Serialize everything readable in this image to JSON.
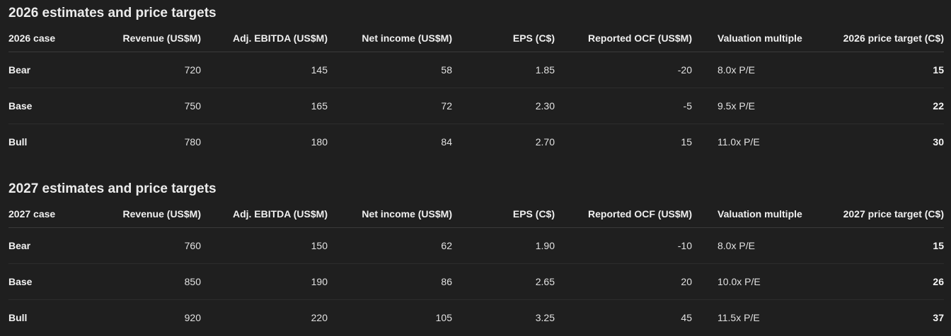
{
  "tables": [
    {
      "title": "2026 estimates and price targets",
      "headers": [
        "2026 case",
        "Revenue (US$M)",
        "Adj. EBITDA (US$M)",
        "Net income (US$M)",
        "EPS (C$)",
        "Reported OCF (US$M)",
        "Valuation multiple",
        "2026 price target (C$)"
      ],
      "rows": [
        [
          "Bear",
          "720",
          "145",
          "58",
          "1.85",
          "-20",
          "8.0x P/E",
          "15"
        ],
        [
          "Base",
          "750",
          "165",
          "72",
          "2.30",
          "-5",
          "9.5x P/E",
          "22"
        ],
        [
          "Bull",
          "780",
          "180",
          "84",
          "2.70",
          "15",
          "11.0x P/E",
          "30"
        ]
      ]
    },
    {
      "title": "2027 estimates and price targets",
      "headers": [
        "2027 case",
        "Revenue (US$M)",
        "Adj. EBITDA (US$M)",
        "Net income (US$M)",
        "EPS (C$)",
        "Reported OCF (US$M)",
        "Valuation multiple",
        "2027 price target (C$)"
      ],
      "rows": [
        [
          "Bear",
          "760",
          "150",
          "62",
          "1.90",
          "-10",
          "8.0x P/E",
          "15"
        ],
        [
          "Base",
          "850",
          "190",
          "86",
          "2.65",
          "20",
          "10.0x P/E",
          "26"
        ],
        [
          "Bull",
          "920",
          "220",
          "105",
          "3.25",
          "45",
          "11.5x P/E",
          "37"
        ]
      ]
    }
  ]
}
